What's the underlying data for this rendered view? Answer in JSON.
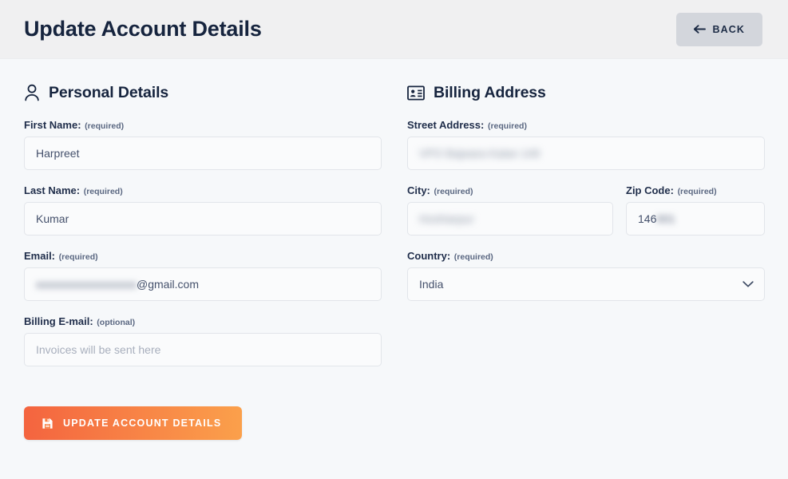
{
  "header": {
    "title": "Update Account Details",
    "back_label": "BACK",
    "back_icon": "arrow-left-icon"
  },
  "personal": {
    "section_title": "Personal Details",
    "section_icon": "user-icon",
    "fields": {
      "first_name": {
        "label": "First Name:",
        "requirement": "(required)",
        "value": "Harpreet"
      },
      "last_name": {
        "label": "Last Name:",
        "requirement": "(required)",
        "value": "Kumar"
      },
      "email": {
        "label": "Email:",
        "requirement": "(required)",
        "value_redacted": "xxxxxxxxxxxxxxxxxx",
        "value_visible": "@gmail.com"
      },
      "billing_email": {
        "label": "Billing E-mail:",
        "requirement": "(optional)",
        "value": "",
        "placeholder": "Invoices will be sent here"
      }
    }
  },
  "billing": {
    "section_title": "Billing Address",
    "section_icon": "id-card-icon",
    "fields": {
      "street_address": {
        "label": "Street Address:",
        "requirement": "(required)",
        "value_redacted": "VPO Bajwara Kalan 149"
      },
      "city": {
        "label": "City:",
        "requirement": "(required)",
        "value_redacted": "Hoshiarpur"
      },
      "zip_code": {
        "label": "Zip Code:",
        "requirement": "(required)",
        "value_visible": "146",
        "value_redacted": "001"
      },
      "country": {
        "label": "Country:",
        "requirement": "(required)",
        "selected": "India",
        "chevron_icon": "chevron-down-icon"
      }
    }
  },
  "submit": {
    "label": "UPDATE ACCOUNT DETAILS",
    "icon": "save-icon"
  },
  "colors": {
    "header_bg": "#f0f0f1",
    "body_bg": "#f6f8fa",
    "title_navy": "#16243e",
    "back_btn_bg": "#d3d6dc",
    "input_border": "#e2e5ea",
    "input_bg": "#fafbfc",
    "submit_gradient_start": "#f4643f",
    "submit_gradient_end": "#fba04b"
  }
}
